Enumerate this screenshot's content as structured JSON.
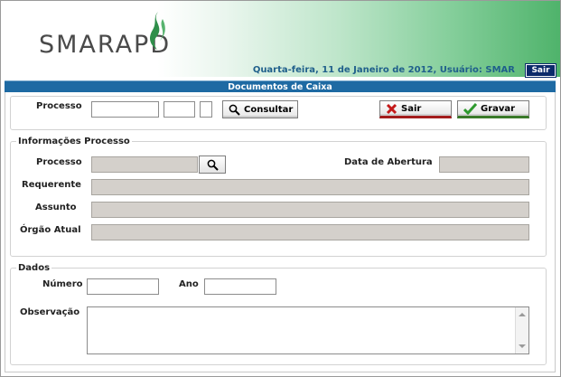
{
  "header": {
    "logo_text": "SMARAPD",
    "user_line": "Quarta-feira, 11 de Janeiro de 2012, Usuário: SMAR",
    "logout_label": "Sair"
  },
  "page": {
    "title": "Documentos de Caixa"
  },
  "search": {
    "processo_label": "Processo",
    "consultar_label": "Consultar",
    "sair_label": "Sair",
    "gravar_label": "Gravar",
    "field1_value": "",
    "field2_value": "",
    "field3_value": ""
  },
  "info": {
    "legend": "Informações Processo",
    "processo_label": "Processo",
    "data_abertura_label": "Data de Abertura",
    "requerente_label": "Requerente",
    "assunto_label": "Assunto",
    "orgao_label": "Órgão Atual",
    "processo_value": "",
    "data_abertura_value": "",
    "requerente_value": "",
    "assunto_value": "",
    "orgao_value": ""
  },
  "dados": {
    "legend": "Dados",
    "numero_label": "Número",
    "ano_label": "Ano",
    "observacao_label": "Observação",
    "numero_value": "",
    "ano_value": "",
    "observacao_value": ""
  },
  "colors": {
    "title_bar": "#1e6aa3",
    "user_line": "#1f5f8b",
    "logout_bg": "#0b2a6a",
    "readonly_field": "#d4d0cb",
    "brand_green": "#4fb36b"
  },
  "icons": {
    "logo": "leaf-logo-icon",
    "consultar": "magnifier-icon",
    "sair": "red-x-icon",
    "gravar": "green-check-icon",
    "lookup": "magnifier-icon"
  }
}
